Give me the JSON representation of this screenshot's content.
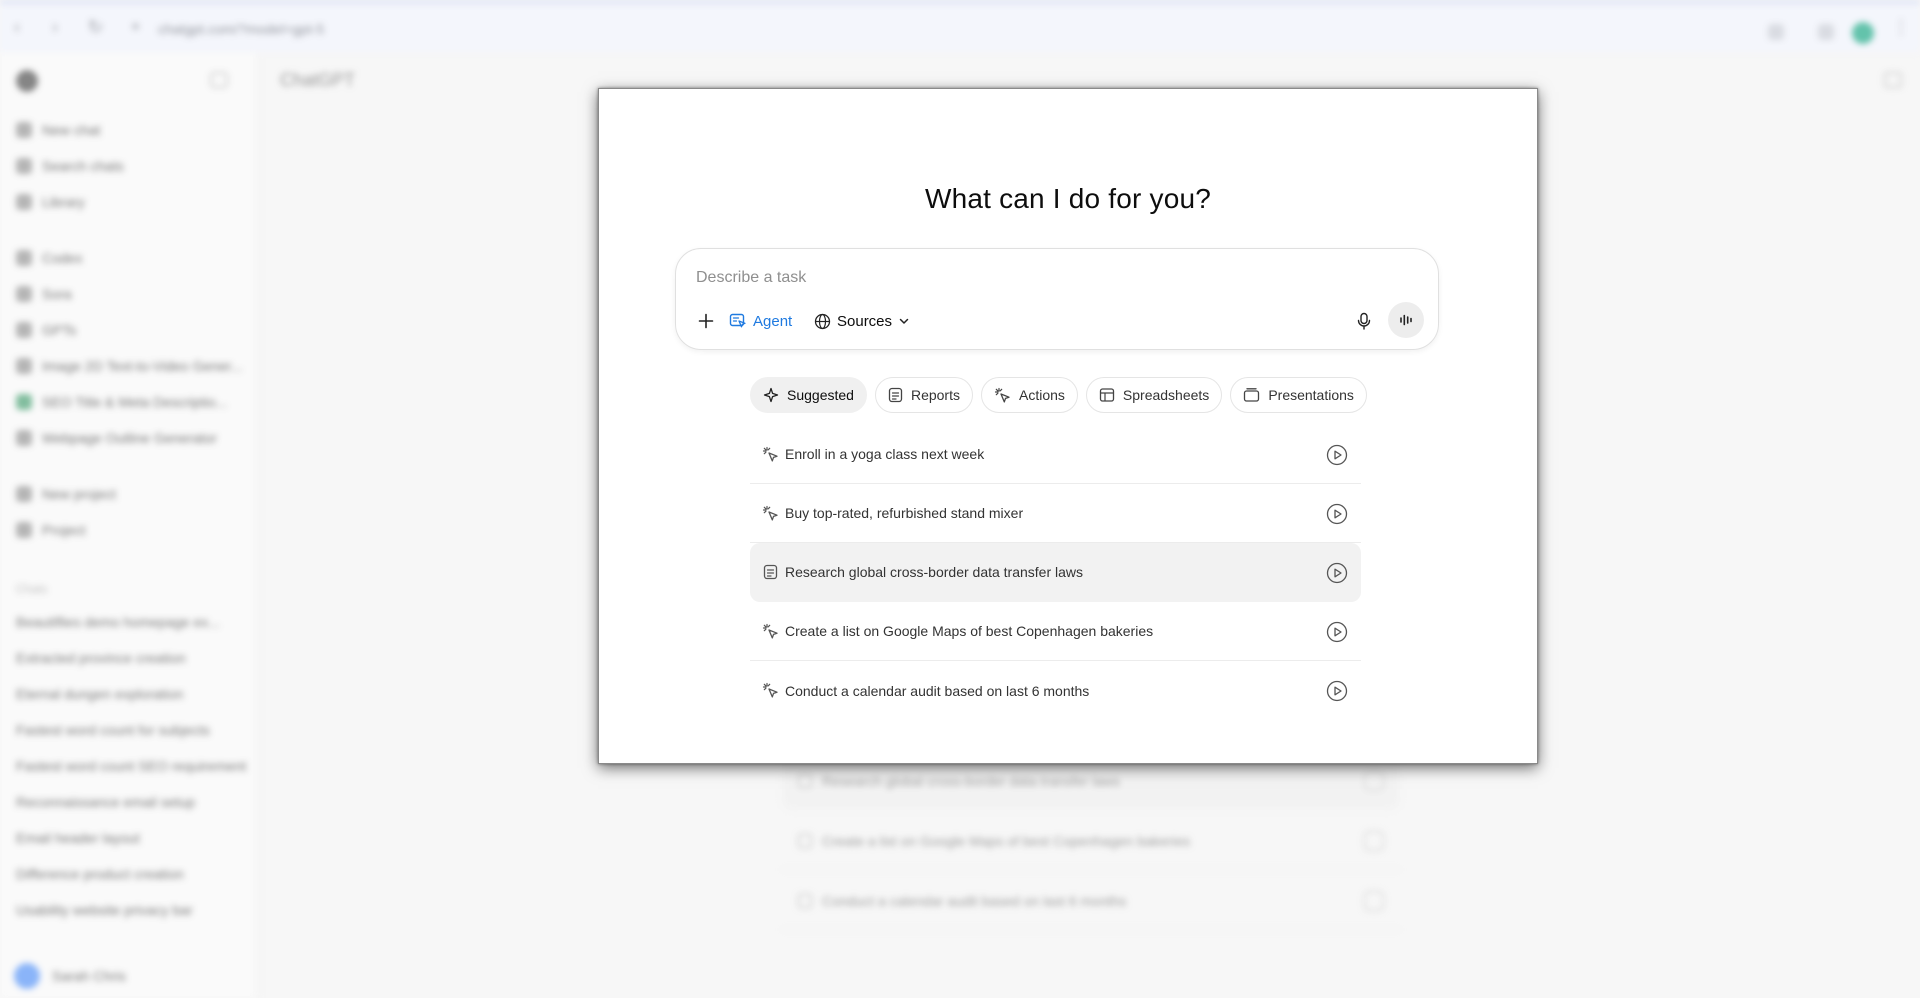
{
  "browser": {
    "url": "chatgpt.com/?model=gpt-5"
  },
  "sidebar": {
    "items": [
      {
        "label": "New chat",
        "icon": "edit-icon"
      },
      {
        "label": "Search chats",
        "icon": "search-icon"
      },
      {
        "label": "Library",
        "icon": "library-icon"
      }
    ],
    "gpts": [
      {
        "label": "Codex",
        "icon": "code-icon"
      },
      {
        "label": "Sora",
        "icon": "sora-icon"
      },
      {
        "label": "GPTs",
        "icon": "grid-icon"
      },
      {
        "label": "Image 2D Text-to-Video Gener...",
        "icon": "gpt-icon"
      },
      {
        "label": "SEO Title & Meta Descriptio...",
        "icon": "gpt-icon"
      },
      {
        "label": "Webpage Outline Generator",
        "icon": "gpt-icon"
      }
    ],
    "projects": [
      {
        "label": "New project",
        "icon": "folder-plus-icon"
      },
      {
        "label": "Project",
        "icon": "folder-icon"
      }
    ],
    "chats_heading": "Chats",
    "chats": [
      "Beautiflies demo homepage ex...",
      "Extracted province creation",
      "Eternal dungen exploration",
      "Fastest word count for subjects",
      "Fastest word count SEO requirement",
      "Reconnaissance email setup",
      "Email header layout",
      "Difference product creation",
      "Usability website privacy bar"
    ],
    "user_name": "Sarah Chris"
  },
  "main": {
    "title": "ChatGPT",
    "background_rows": [
      "Research global cross-border data transfer laws",
      "Create a list on Google Maps of best Copenhagen bakeries",
      "Conduct a calendar audit based on last 6 months"
    ]
  },
  "dialog": {
    "heading": "What can I do for you?",
    "composer": {
      "placeholder": "Describe a task",
      "value": "",
      "agent_label": "Agent",
      "sources_label": "Sources",
      "accent_color": "#1f7ae0"
    },
    "tabs": [
      {
        "label": "Suggested",
        "icon": "sparkle-icon",
        "active": true
      },
      {
        "label": "Reports",
        "icon": "document-icon",
        "active": false
      },
      {
        "label": "Actions",
        "icon": "cursor-sparkle-icon",
        "active": false
      },
      {
        "label": "Spreadsheets",
        "icon": "table-icon",
        "active": false
      },
      {
        "label": "Presentations",
        "icon": "slides-icon",
        "active": false
      }
    ],
    "suggestions": [
      {
        "text": "Enroll in a yoga class next week",
        "icon": "cursor-sparkle-icon",
        "highlighted": false
      },
      {
        "text": "Buy top-rated, refurbished stand mixer",
        "icon": "cursor-sparkle-icon",
        "highlighted": false
      },
      {
        "text": "Research global cross-border data transfer laws",
        "icon": "document-icon",
        "highlighted": true
      },
      {
        "text": "Create a list on Google Maps of best Copenhagen bakeries",
        "icon": "cursor-sparkle-icon",
        "highlighted": false
      },
      {
        "text": "Conduct a calendar audit based on last 6 months",
        "icon": "cursor-sparkle-icon",
        "highlighted": false
      }
    ]
  }
}
